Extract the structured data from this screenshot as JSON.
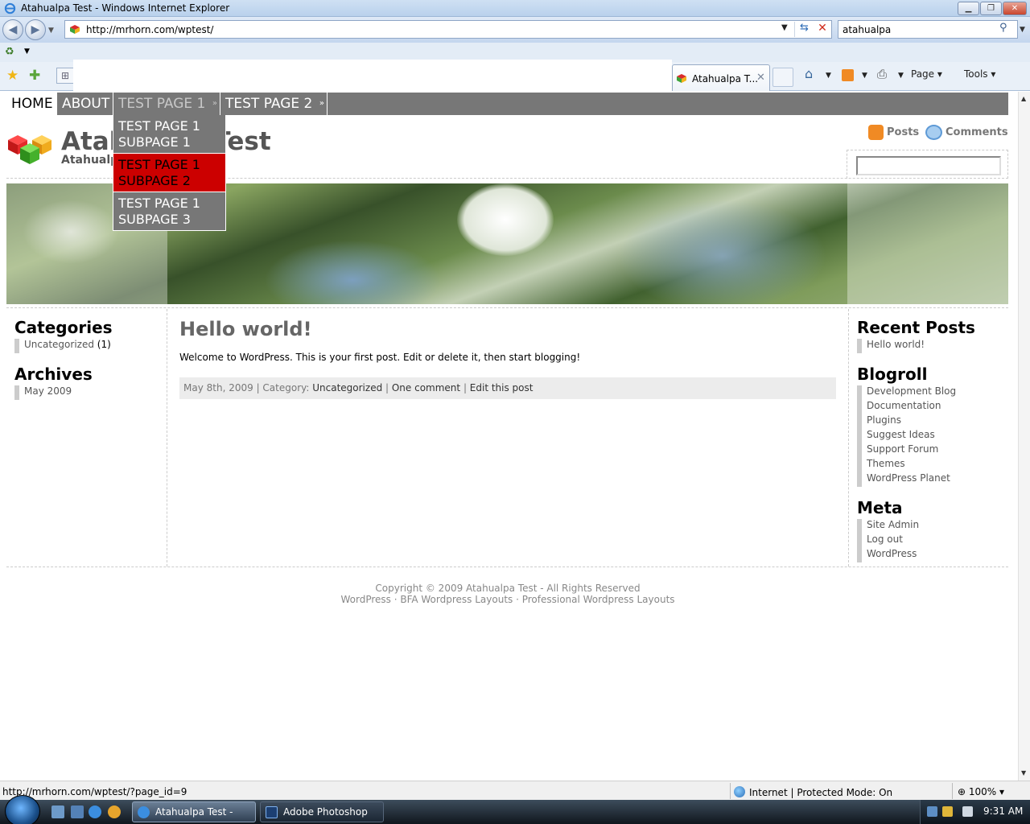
{
  "window": {
    "title": "Atahualpa Test - Windows Internet Explorer",
    "min_glyph": "▁",
    "max_glyph": "❐",
    "close_glyph": "✕"
  },
  "navigation": {
    "back_glyph": "◀",
    "forward_glyph": "▶",
    "dropdown_glyph": "▼",
    "url": "http://mrhorn.com/wptest/",
    "refresh_glyph": "⇆",
    "stop_glyph": "✕",
    "search_value": "atahualpa",
    "search_glyph": "⚲"
  },
  "command_bar": {
    "tab_label": "Atahualpa T...",
    "tab_close_glyph": "✕",
    "page_label": "Page ▾",
    "tools_label": "Tools ▾",
    "home_glyph": "⌂",
    "print_glyph": "⎙",
    "dropdown_glyph": "▼",
    "star_glyph": "★",
    "add_fav_glyph": "✚",
    "quick_tabs_glyph": "⊞"
  },
  "site": {
    "menu": {
      "home": "HOME",
      "about": "ABOUT",
      "test1": "TEST PAGE 1",
      "test2": "TEST PAGE 2",
      "arrow": "»"
    },
    "dropdown": [
      {
        "line1": "TEST PAGE 1",
        "line2": "SUBPAGE 1"
      },
      {
        "line1": "TEST PAGE 1",
        "line2": "SUBPAGE 2"
      },
      {
        "line1": "TEST PAGE 1",
        "line2": "SUBPAGE 3"
      }
    ],
    "title": "Atahualpa Test",
    "description": "Atahualpa",
    "feed_posts": "Posts",
    "feed_comments": "Comments"
  },
  "sidebar_left": {
    "categories_title": "Categories",
    "category_link": "Uncategorized",
    "category_count": " (1)",
    "archives_title": "Archives",
    "archive_link": "May 2009"
  },
  "post": {
    "title": "Hello world!",
    "body": "Welcome to WordPress. This is your first post. Edit or delete it, then start blogging!",
    "date": "May 8th, 2009",
    "sep": " | ",
    "category_label": "Category: ",
    "category": "Uncategorized",
    "comments": "One comment",
    "edit": "Edit this post"
  },
  "sidebar_right": {
    "recent_title": "Recent Posts",
    "recent": [
      "Hello world!"
    ],
    "blogroll_title": "Blogroll",
    "blogroll": [
      "Development Blog",
      "Documentation",
      "Plugins",
      "Suggest Ideas",
      "Support Forum",
      "Themes",
      "WordPress Planet"
    ],
    "meta_title": "Meta",
    "meta": [
      "Site Admin",
      "Log out",
      "WordPress"
    ]
  },
  "footer": {
    "line1": "Copyright © 2009 Atahualpa Test - All Rights Reserved",
    "line2": "WordPress · BFA Wordpress Layouts · Professional Wordpress Layouts"
  },
  "status_bar": {
    "url": "http://mrhorn.com/wptest/?page_id=9",
    "zone": "Internet | Protected Mode: On",
    "zoom": "100%"
  },
  "taskbar": {
    "ie_task": "Atahualpa Test - Wi...",
    "ps_task": "Adobe Photoshop C...",
    "clock": "9:31 AM"
  }
}
